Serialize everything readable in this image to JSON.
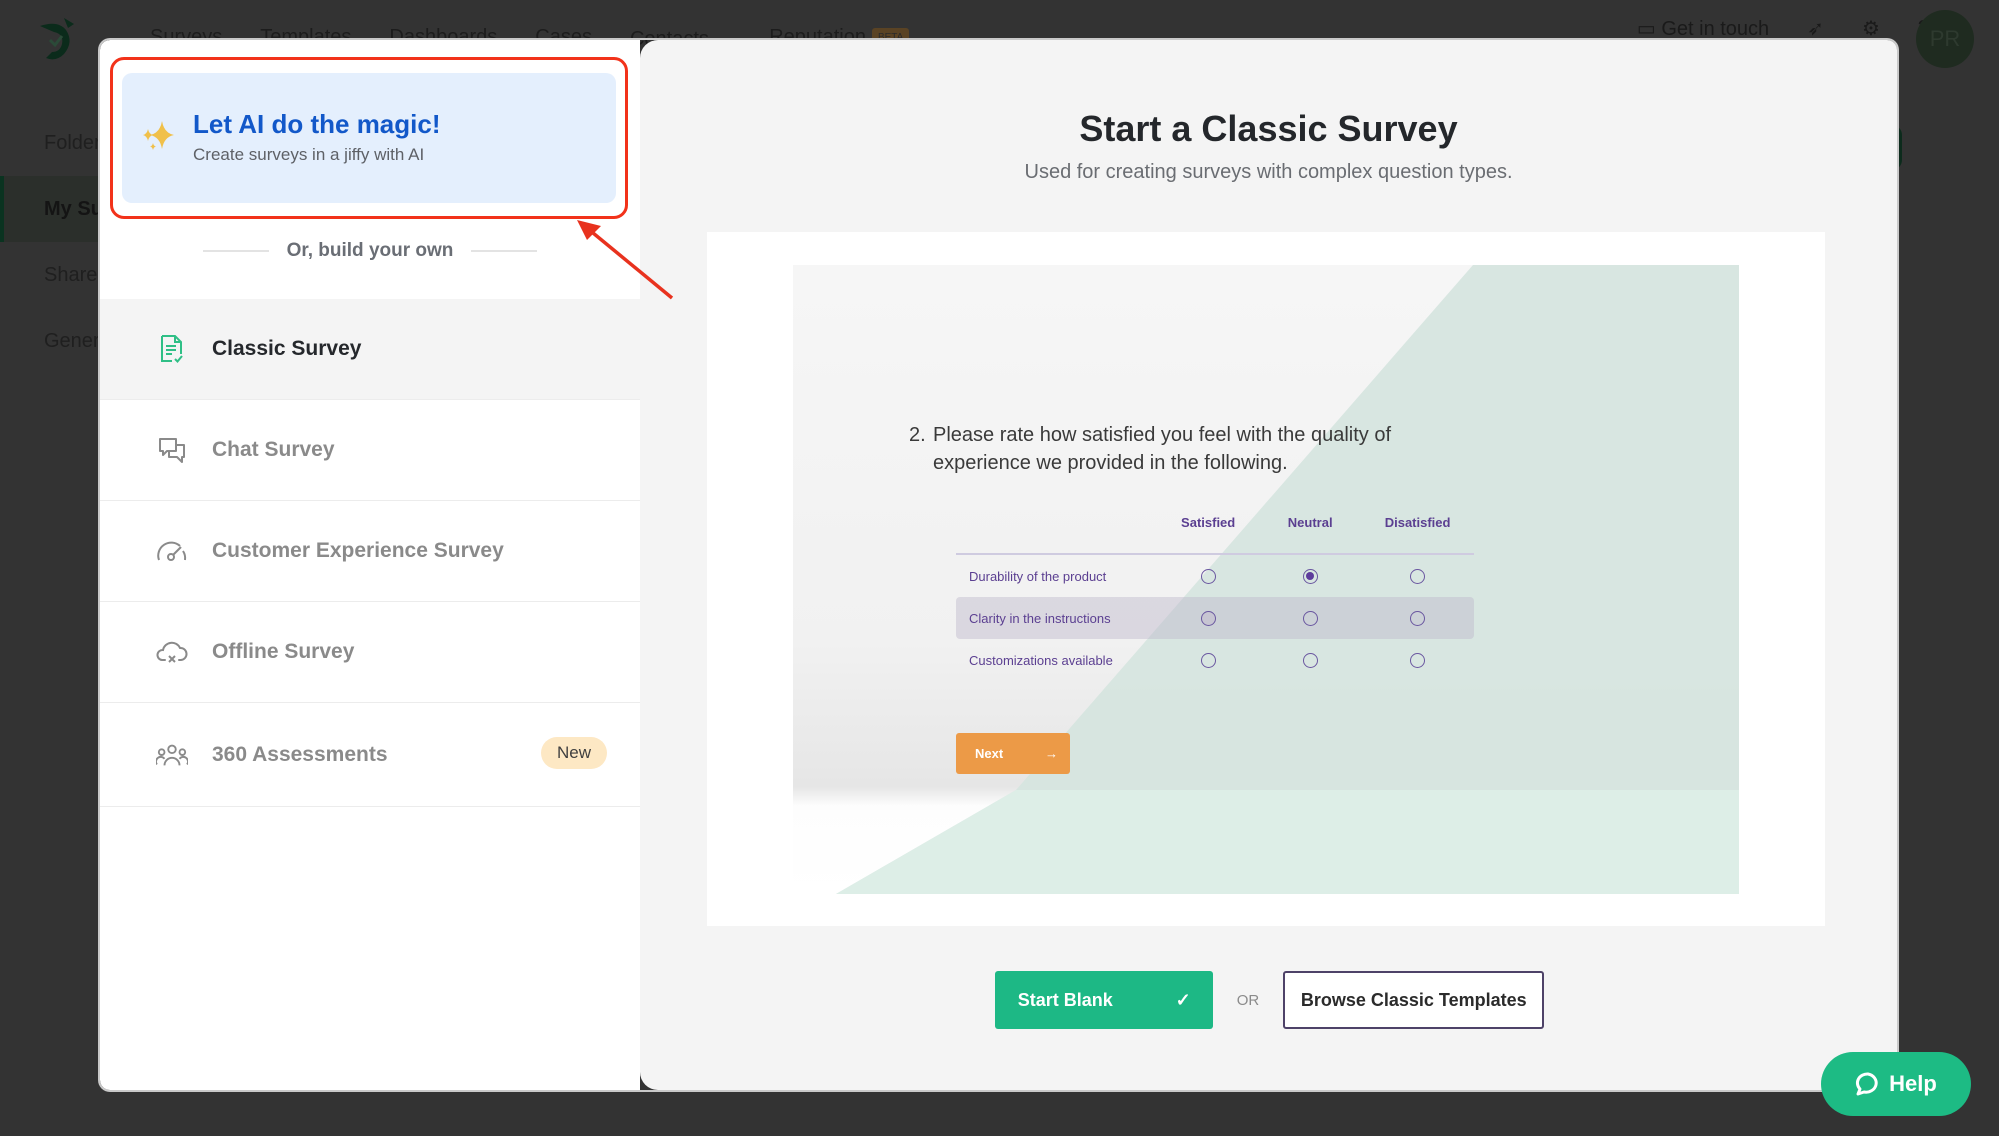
{
  "background": {
    "nav": [
      "Surveys",
      "Templates",
      "Dashboards",
      "Cases",
      "Contacts",
      "Reputation"
    ],
    "nav_badge": "BETA",
    "get_in_touch": "Get in touch",
    "avatar_initials": "PR",
    "sidebar": [
      "Folders",
      "My Surveys",
      "Shared",
      "General"
    ]
  },
  "ai_card": {
    "title": "Let AI do the magic!",
    "subtitle": "Create surveys in a jiffy with AI"
  },
  "divider_text": "Or, build your own",
  "survey_types": [
    {
      "label": "Classic Survey",
      "icon": "document-check-icon",
      "selected": true
    },
    {
      "label": "Chat Survey",
      "icon": "chat-bubbles-icon",
      "selected": false
    },
    {
      "label": "Customer Experience Survey",
      "icon": "gauge-icon",
      "selected": false
    },
    {
      "label": "Offline Survey",
      "icon": "cloud-off-icon",
      "selected": false
    },
    {
      "label": "360 Assessments",
      "icon": "people-group-icon",
      "selected": false,
      "badge": "New"
    }
  ],
  "preview": {
    "title": "Start a Classic Survey",
    "subtitle": "Used for creating surveys with complex question types.",
    "question_number": "2.",
    "question_text": "Please rate how satisfied you feel with the quality of experience we provided in the following.",
    "columns": [
      "Satisfied",
      "Neutral",
      "Disatisfied"
    ],
    "rows": [
      {
        "label": "Durability of the product",
        "selected": 1
      },
      {
        "label": "Clarity in the instructions",
        "selected": null
      },
      {
        "label": "Customizations available",
        "selected": null
      }
    ],
    "next_label": "Next"
  },
  "actions": {
    "start_blank": "Start Blank",
    "or": "OR",
    "browse": "Browse Classic Templates"
  },
  "help": {
    "label": "Help"
  },
  "colors": {
    "accent_green": "#1db885",
    "ai_blue": "#1258c9",
    "highlight_red": "#f2321a",
    "next_orange": "#ec9a47",
    "matrix_purple": "#5b3f91"
  }
}
